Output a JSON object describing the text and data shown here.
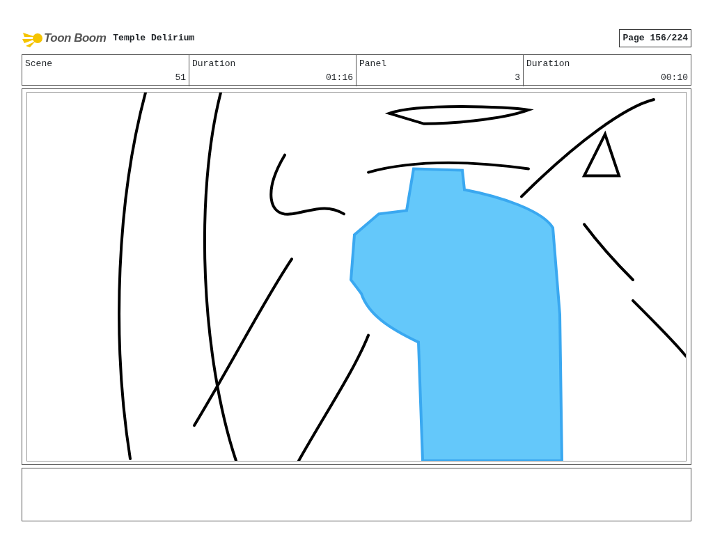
{
  "header": {
    "logo_text": "Toon Boom",
    "project_title": "Temple Delirium",
    "page": "Page 156/224"
  },
  "info_table": {
    "columns": [
      "Scene",
      "Duration",
      "Panel",
      "Duration"
    ],
    "row": [
      "51",
      "01:16",
      "3",
      "00:10"
    ]
  },
  "panel": {
    "kind": "sketch"
  }
}
